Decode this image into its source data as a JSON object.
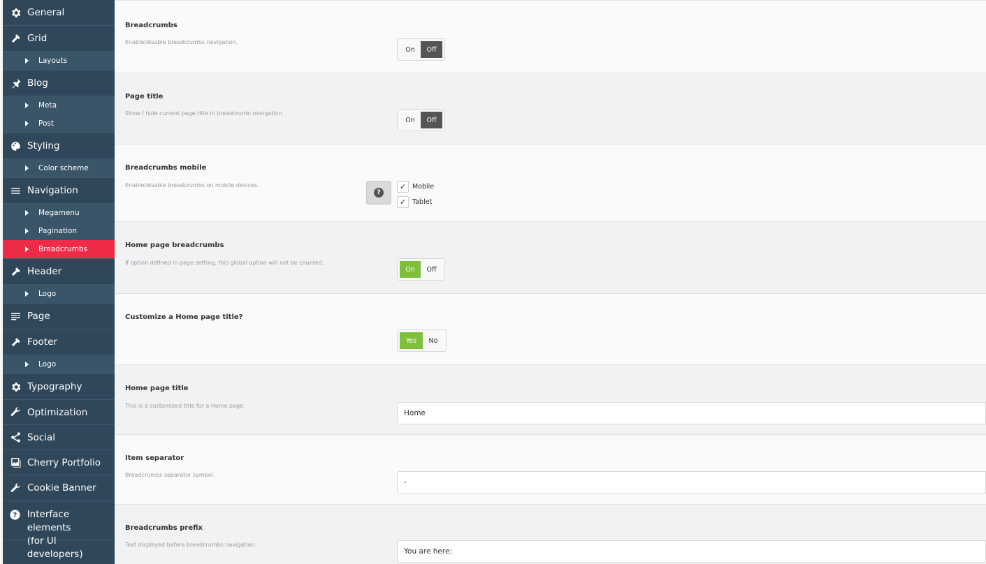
{
  "sidebar": {
    "items": [
      {
        "label": "General",
        "icon": "gear-icon"
      },
      {
        "label": "Grid",
        "icon": "hammer-icon",
        "sub": [
          "Layouts"
        ]
      },
      {
        "label": "Blog",
        "icon": "pin-icon",
        "sub": [
          "Meta",
          "Post"
        ]
      },
      {
        "label": "Styling",
        "icon": "palette-icon",
        "sub": [
          "Color scheme"
        ]
      },
      {
        "label": "Navigation",
        "icon": "menu-icon",
        "sub": [
          "Megamenu",
          "Pagination",
          "Breadcrumbs"
        ]
      },
      {
        "label": "Header",
        "icon": "hammer-icon",
        "sub": [
          "Logo"
        ]
      },
      {
        "label": "Page",
        "icon": "page-icon"
      },
      {
        "label": "Footer",
        "icon": "hammer-icon",
        "sub": [
          "Logo"
        ]
      },
      {
        "label": "Typography",
        "icon": "gear-icon"
      },
      {
        "label": "Optimization",
        "icon": "wrench-icon"
      },
      {
        "label": "Social",
        "icon": "share-icon"
      },
      {
        "label": "Cherry Portfolio",
        "icon": "gallery-icon"
      },
      {
        "label": "Cookie Banner",
        "icon": "wrench-icon"
      },
      {
        "label": "Interface elements\n(for UI developers)",
        "icon": "question-icon"
      }
    ],
    "active_sub": "Breadcrumbs"
  },
  "settings": {
    "breadcrumbs": {
      "title": "Breadcrumbs",
      "desc": "Enable/disable breadcrumbs navigation.",
      "on": "On",
      "off": "Off",
      "value": "Off"
    },
    "page_title": {
      "title": "Page title",
      "desc": "Show / hide current page title in breadcrumb navigation.",
      "on": "On",
      "off": "Off",
      "value": "Off"
    },
    "breadcrumbs_mobile": {
      "title": "Breadcrumbs mobile",
      "desc": "Enable/disable breadcrumbs on mobile devices.",
      "help": "?",
      "options": [
        {
          "label": "Mobile",
          "checked": true
        },
        {
          "label": "Tablet",
          "checked": true
        }
      ]
    },
    "home_breadcrumbs": {
      "title": "Home page breadcrumbs",
      "desc": "If option defined in page setting, this global option will not be counted.",
      "on": "On",
      "off": "Off",
      "value": "On"
    },
    "customize_home": {
      "title": "Customize a Home page title?",
      "yes": "Yes",
      "no": "No",
      "value": "Yes"
    },
    "home_title": {
      "title": "Home page title",
      "desc": "This is a customized title for a Home page.",
      "value": "Home"
    },
    "separator": {
      "title": "Item separator",
      "desc": "Breadcrumbs separator symbol.",
      "value": "-"
    },
    "prefix": {
      "title": "Breadcrumbs prefix",
      "desc": "Text displayed before breadcrumbs navigation.",
      "value": "You are here:"
    }
  },
  "colors": {
    "sidebar": "#2f4759",
    "active": "#ef2c48",
    "toggle_on": "#7fbf3b",
    "toggle_off": "#555555"
  }
}
